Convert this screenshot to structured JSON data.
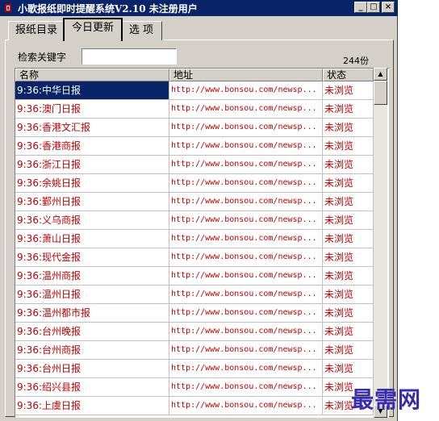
{
  "window": {
    "title": "小歌报纸即时提醒系统V2.10   未注册用户",
    "minimize_glyph": "_",
    "maximize_glyph": "□",
    "close_glyph": "×"
  },
  "tabs": [
    {
      "label": "报纸目录"
    },
    {
      "label": "今日更新"
    },
    {
      "label": "选 项"
    }
  ],
  "search": {
    "label": "检索关键字",
    "value": ""
  },
  "count_text": "244份",
  "table": {
    "columns": [
      "名称",
      "地址",
      "状态"
    ],
    "rows": [
      {
        "name": "9:36:中华日报",
        "url": "http://www.bonsou.com/newsp...",
        "status": "未浏览"
      },
      {
        "name": "9:36:澳门日报",
        "url": "http://www.bonsou.com/newsp...",
        "status": "未浏览"
      },
      {
        "name": "9:36:香港文汇报",
        "url": "http://www.bonsou.com/newsp...",
        "status": "未浏览"
      },
      {
        "name": "9:36:香港商报",
        "url": "http://www.bonsou.com/newsp...",
        "status": "未浏览"
      },
      {
        "name": "9:36:浙江日报",
        "url": "http://www.bonsou.com/newsp...",
        "status": "未浏览"
      },
      {
        "name": "9:36:余姚日报",
        "url": "http://www.bonsou.com/newsp...",
        "status": "未浏览"
      },
      {
        "name": "9:36:鄞州日报",
        "url": "http://www.bonsou.com/newsp...",
        "status": "未浏览"
      },
      {
        "name": "9:36:义乌商报",
        "url": "http://www.bonsou.com/newsp...",
        "status": "未浏览"
      },
      {
        "name": "9:36:萧山日报",
        "url": "http://www.bonsou.com/newsp...",
        "status": "未浏览"
      },
      {
        "name": "9:36:现代金报",
        "url": "http://www.bonsou.com/newsp...",
        "status": "未浏览"
      },
      {
        "name": "9:36:温州商报",
        "url": "http://www.bonsou.com/newsp...",
        "status": "未浏览"
      },
      {
        "name": "9:36:温州日报",
        "url": "http://www.bonsou.com/newsp...",
        "status": "未浏览"
      },
      {
        "name": "9:36:温州都市报",
        "url": "http://www.bonsou.com/newsp...",
        "status": "未浏览"
      },
      {
        "name": "9:36:台州晚报",
        "url": "http://www.bonsou.com/newsp...",
        "status": "未浏览"
      },
      {
        "name": "9:36:台州商报",
        "url": "http://www.bonsou.com/newsp...",
        "status": "未浏览"
      },
      {
        "name": "9:36:台州日报",
        "url": "http://www.bonsou.com/newsp...",
        "status": "未浏览"
      },
      {
        "name": "9:36:绍兴县报",
        "url": "http://www.bonsou.com/newsp...",
        "status": "未浏览"
      },
      {
        "name": "9:36:上虞日报",
        "url": "http://www.bonsou.com/newsp...",
        "status": "未浏览"
      }
    ]
  },
  "scrollbar": {
    "up_glyph": "▲",
    "down_glyph": "▼"
  },
  "watermark": "最需网",
  "colors": {
    "title_bar": "#0a246a",
    "row_text": "#c00000",
    "selection": "#0a246a",
    "watermark": "#3a2cae"
  }
}
